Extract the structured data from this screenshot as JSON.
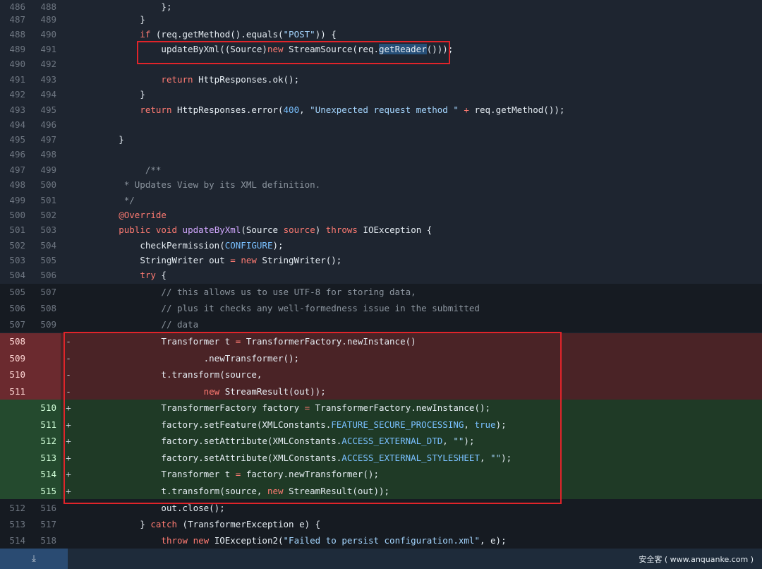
{
  "lines": [
    {
      "type": "ctx",
      "old": "486",
      "new": "488",
      "indent": 4,
      "segs": [
        [
          "pl",
          "};"
        ]
      ]
    },
    {
      "type": "ctx",
      "old": "487",
      "new": "489",
      "indent": 3,
      "segs": [
        [
          "pl",
          "}"
        ]
      ]
    },
    {
      "type": "ctx",
      "old": "488",
      "new": "490",
      "indent": 3,
      "segs": [
        [
          "kw",
          "if"
        ],
        [
          "pl",
          " (req.getMethod().equals("
        ],
        [
          "str",
          "\"POST\""
        ],
        [
          "pl",
          ")) {"
        ]
      ]
    },
    {
      "type": "ctx",
      "old": "489",
      "new": "491",
      "indent": 4,
      "segs": [
        [
          "pl",
          "updateByXml(("
        ],
        [
          "pl",
          "Source"
        ],
        [
          "pl",
          ")"
        ],
        [
          "kw",
          "new"
        ],
        [
          "pl",
          " StreamSource(req."
        ],
        [
          "hl",
          "getReader"
        ],
        [
          "pl",
          "()));"
        ]
      ]
    },
    {
      "type": "ctx",
      "old": "490",
      "new": "492",
      "indent": 0,
      "segs": []
    },
    {
      "type": "ctx",
      "old": "491",
      "new": "493",
      "indent": 4,
      "segs": [
        [
          "kw",
          "return"
        ],
        [
          "pl",
          " HttpResponses.ok();"
        ]
      ]
    },
    {
      "type": "ctx",
      "old": "492",
      "new": "494",
      "indent": 3,
      "segs": [
        [
          "pl",
          "}"
        ]
      ]
    },
    {
      "type": "ctx",
      "old": "493",
      "new": "495",
      "indent": 3,
      "segs": [
        [
          "kw",
          "return"
        ],
        [
          "pl",
          " HttpResponses.error("
        ],
        [
          "num",
          "400"
        ],
        [
          "pl",
          ", "
        ],
        [
          "str",
          "\"Unexpected request method \""
        ],
        [
          "kw",
          " +"
        ],
        [
          "pl",
          " req.getMethod());"
        ]
      ]
    },
    {
      "type": "ctx",
      "old": "494",
      "new": "496",
      "indent": 0,
      "segs": []
    },
    {
      "type": "ctx",
      "old": "495",
      "new": "497",
      "indent": 2,
      "segs": [
        [
          "pl",
          "}"
        ]
      ]
    },
    {
      "type": "ctx",
      "old": "496",
      "new": "498",
      "indent": 0,
      "segs": []
    },
    {
      "type": "ctx",
      "old": "497",
      "new": "499",
      "indent": 2,
      "pre": "     ",
      "segs": [
        [
          "com",
          "/**"
        ]
      ]
    },
    {
      "type": "ctx",
      "old": "498",
      "new": "500",
      "indent": 2,
      "pre": " ",
      "segs": [
        [
          "com",
          "* Updates View by its XML definition."
        ]
      ]
    },
    {
      "type": "ctx",
      "old": "499",
      "new": "501",
      "indent": 2,
      "pre": " ",
      "segs": [
        [
          "com",
          "*/"
        ]
      ]
    },
    {
      "type": "ctx",
      "old": "500",
      "new": "502",
      "indent": 2,
      "segs": [
        [
          "kw",
          "@Override"
        ]
      ]
    },
    {
      "type": "ctx",
      "old": "501",
      "new": "503",
      "indent": 2,
      "segs": [
        [
          "kw",
          "public"
        ],
        [
          "pl",
          " "
        ],
        [
          "kw",
          "void"
        ],
        [
          "pl",
          " "
        ],
        [
          "fn",
          "updateByXml"
        ],
        [
          "pl",
          "(Source "
        ],
        [
          "kw",
          "source"
        ],
        [
          "pl",
          ") "
        ],
        [
          "kw",
          "throws"
        ],
        [
          "pl",
          " IOException {"
        ]
      ]
    },
    {
      "type": "ctx",
      "old": "502",
      "new": "504",
      "indent": 3,
      "segs": [
        [
          "pl",
          "checkPermission("
        ],
        [
          "const",
          "CONFIGURE"
        ],
        [
          "pl",
          ");"
        ]
      ]
    },
    {
      "type": "ctx",
      "old": "503",
      "new": "505",
      "indent": 3,
      "segs": [
        [
          "pl",
          "StringWriter out "
        ],
        [
          "kw",
          "="
        ],
        [
          "pl",
          " "
        ],
        [
          "kw",
          "new"
        ],
        [
          "pl",
          " StringWriter();"
        ]
      ]
    },
    {
      "type": "ctx",
      "old": "504",
      "new": "506",
      "indent": 3,
      "segs": [
        [
          "kw",
          "try"
        ],
        [
          "pl",
          " {"
        ]
      ]
    },
    {
      "type": "ctx2",
      "old": "505",
      "new": "507",
      "indent": 4,
      "segs": [
        [
          "com",
          "// this allows us to use UTF-8 for storing data,"
        ]
      ]
    },
    {
      "type": "ctx2",
      "old": "506",
      "new": "508",
      "indent": 4,
      "segs": [
        [
          "com",
          "// plus it checks any well-formedness issue in the submitted"
        ]
      ]
    },
    {
      "type": "ctx2",
      "old": "507",
      "new": "509",
      "indent": 4,
      "segs": [
        [
          "com",
          "// data"
        ]
      ]
    },
    {
      "type": "del",
      "old": "508",
      "new": "",
      "marker": "-",
      "indent": 4,
      "segs": [
        [
          "pl",
          "Transformer t "
        ],
        [
          "kw",
          "="
        ],
        [
          "pl",
          " TransformerFactory.newInstance()"
        ]
      ]
    },
    {
      "type": "del",
      "old": "509",
      "new": "",
      "marker": "-",
      "indent": 4,
      "pre": "        ",
      "segs": [
        [
          "pl",
          ".newTransformer();"
        ]
      ]
    },
    {
      "type": "del",
      "old": "510",
      "new": "",
      "marker": "-",
      "indent": 4,
      "segs": [
        [
          "pl",
          "t.transform(source,"
        ]
      ]
    },
    {
      "type": "del",
      "old": "511",
      "new": "",
      "marker": "-",
      "indent": 4,
      "pre": "        ",
      "segs": [
        [
          "kw",
          "new"
        ],
        [
          "pl",
          " StreamResult(out));"
        ]
      ]
    },
    {
      "type": "add",
      "old": "",
      "new": "510",
      "marker": "+",
      "indent": 4,
      "segs": [
        [
          "pl",
          "TransformerFactory factory "
        ],
        [
          "kw",
          "="
        ],
        [
          "pl",
          " TransformerFactory.newInstance();"
        ]
      ]
    },
    {
      "type": "add",
      "old": "",
      "new": "511",
      "marker": "+",
      "indent": 4,
      "segs": [
        [
          "pl",
          "factory.setFeature(XMLConstants."
        ],
        [
          "const",
          "FEATURE_SECURE_PROCESSING"
        ],
        [
          "pl",
          ", "
        ],
        [
          "const",
          "true"
        ],
        [
          "pl",
          ");"
        ]
      ]
    },
    {
      "type": "add",
      "old": "",
      "new": "512",
      "marker": "+",
      "indent": 4,
      "segs": [
        [
          "pl",
          "factory.setAttribute(XMLConstants."
        ],
        [
          "const",
          "ACCESS_EXTERNAL_DTD"
        ],
        [
          "pl",
          ", "
        ],
        [
          "str",
          "\"\""
        ],
        [
          "pl",
          ");"
        ]
      ]
    },
    {
      "type": "add",
      "old": "",
      "new": "513",
      "marker": "+",
      "indent": 4,
      "segs": [
        [
          "pl",
          "factory.setAttribute(XMLConstants."
        ],
        [
          "const",
          "ACCESS_EXTERNAL_STYLESHEET"
        ],
        [
          "pl",
          ", "
        ],
        [
          "str",
          "\"\""
        ],
        [
          "pl",
          ");"
        ]
      ]
    },
    {
      "type": "add",
      "old": "",
      "new": "514",
      "marker": "+",
      "indent": 4,
      "segs": [
        [
          "pl",
          "Transformer t "
        ],
        [
          "kw",
          "="
        ],
        [
          "pl",
          " factory.newTransformer();"
        ]
      ]
    },
    {
      "type": "add",
      "old": "",
      "new": "515",
      "marker": "+",
      "indent": 4,
      "segs": [
        [
          "pl",
          "t.transform(source, "
        ],
        [
          "kw",
          "new"
        ],
        [
          "pl",
          " StreamResult(out));"
        ]
      ]
    },
    {
      "type": "ctx2",
      "old": "512",
      "new": "516",
      "indent": 4,
      "segs": [
        [
          "pl",
          "out.close();"
        ]
      ]
    },
    {
      "type": "ctx2",
      "old": "513",
      "new": "517",
      "indent": 3,
      "segs": [
        [
          "pl",
          "} "
        ],
        [
          "kw",
          "catch"
        ],
        [
          "pl",
          " (TransformerException e) {"
        ]
      ]
    },
    {
      "type": "ctx2",
      "old": "514",
      "new": "518",
      "indent": 4,
      "segs": [
        [
          "kw",
          "throw"
        ],
        [
          "pl",
          " "
        ],
        [
          "kw",
          "new"
        ],
        [
          "pl",
          " IOException2("
        ],
        [
          "str",
          "\"Failed to persist configuration.xml\""
        ],
        [
          "pl",
          ", e);"
        ]
      ]
    }
  ],
  "footer": {
    "expand_icon": "expand-down-icon",
    "expand_glyph": "⤓",
    "watermark": "安全客 ( www.anquanke.com )"
  },
  "colors": {
    "background": "#1e2530",
    "deleted_row": "#4a2326",
    "added_row": "#1f3a26",
    "highlight_box": "#e0242a"
  }
}
